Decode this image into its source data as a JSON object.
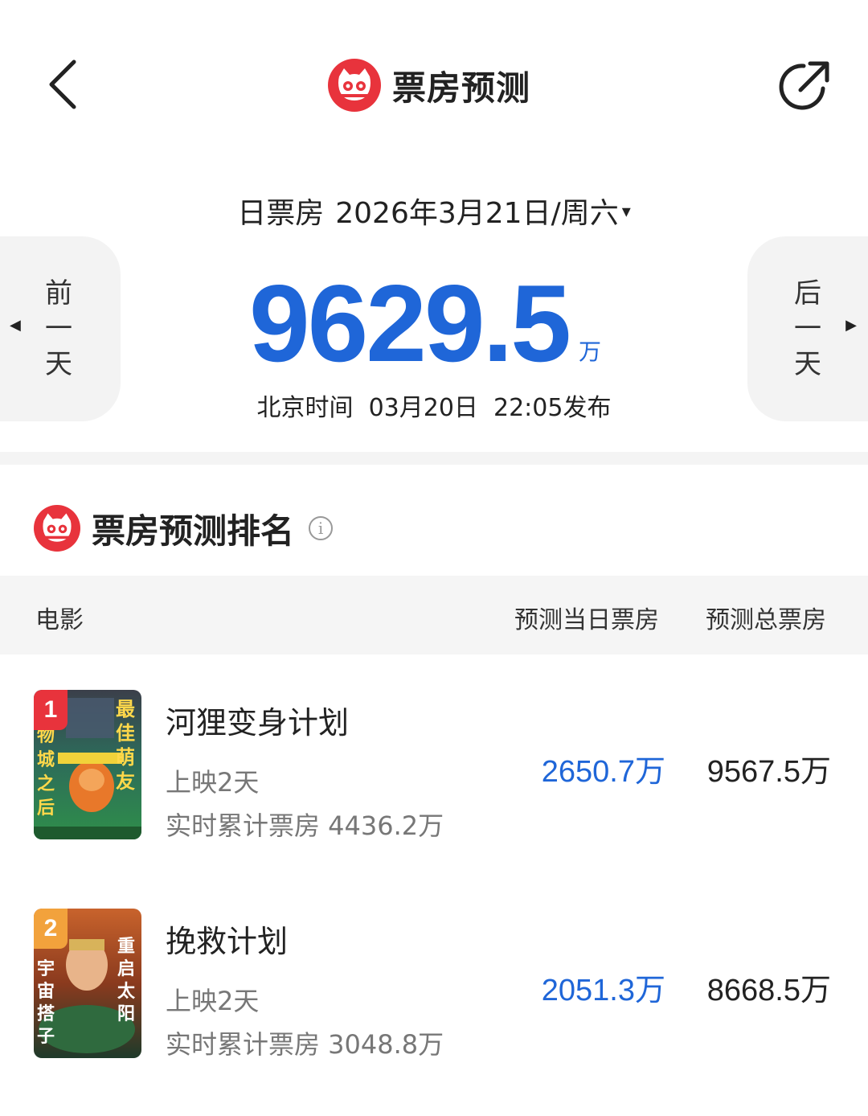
{
  "header": {
    "title": "票房预测",
    "back_icon": "chevron-left-icon",
    "share_icon": "share-icon",
    "logo_icon": "maoyan-cat-logo",
    "brand_color": "#e8333c"
  },
  "date_selector": {
    "label": "日票房",
    "date": "2026年3月21日/周六",
    "caret": "▾"
  },
  "nav": {
    "prev_label": "前一天",
    "next_label": "后一天"
  },
  "total": {
    "value": "9629.5",
    "unit": "万",
    "color": "#1f66d8"
  },
  "publish_time": "北京时间  03月20日  22:05发布",
  "ranking": {
    "title": "票房预测排名",
    "info_icon": "info-icon",
    "columns": {
      "movie": "电影",
      "day_forecast": "预测当日票房",
      "total_forecast": "预测总票房"
    },
    "rows": [
      {
        "rank": "1",
        "badge_color": "#e8333c",
        "name": "河狸变身计划",
        "days": "上映2天",
        "cumulative": "实时累计票房 4436.2万",
        "day_forecast": "2650.7万",
        "total_forecast": "9567.5万"
      },
      {
        "rank": "2",
        "badge_color": "#f2a23c",
        "name": "挽救计划",
        "days": "上映2天",
        "cumulative": "实时累计票房 3048.8万",
        "day_forecast": "2051.3万",
        "total_forecast": "8668.5万"
      }
    ]
  }
}
